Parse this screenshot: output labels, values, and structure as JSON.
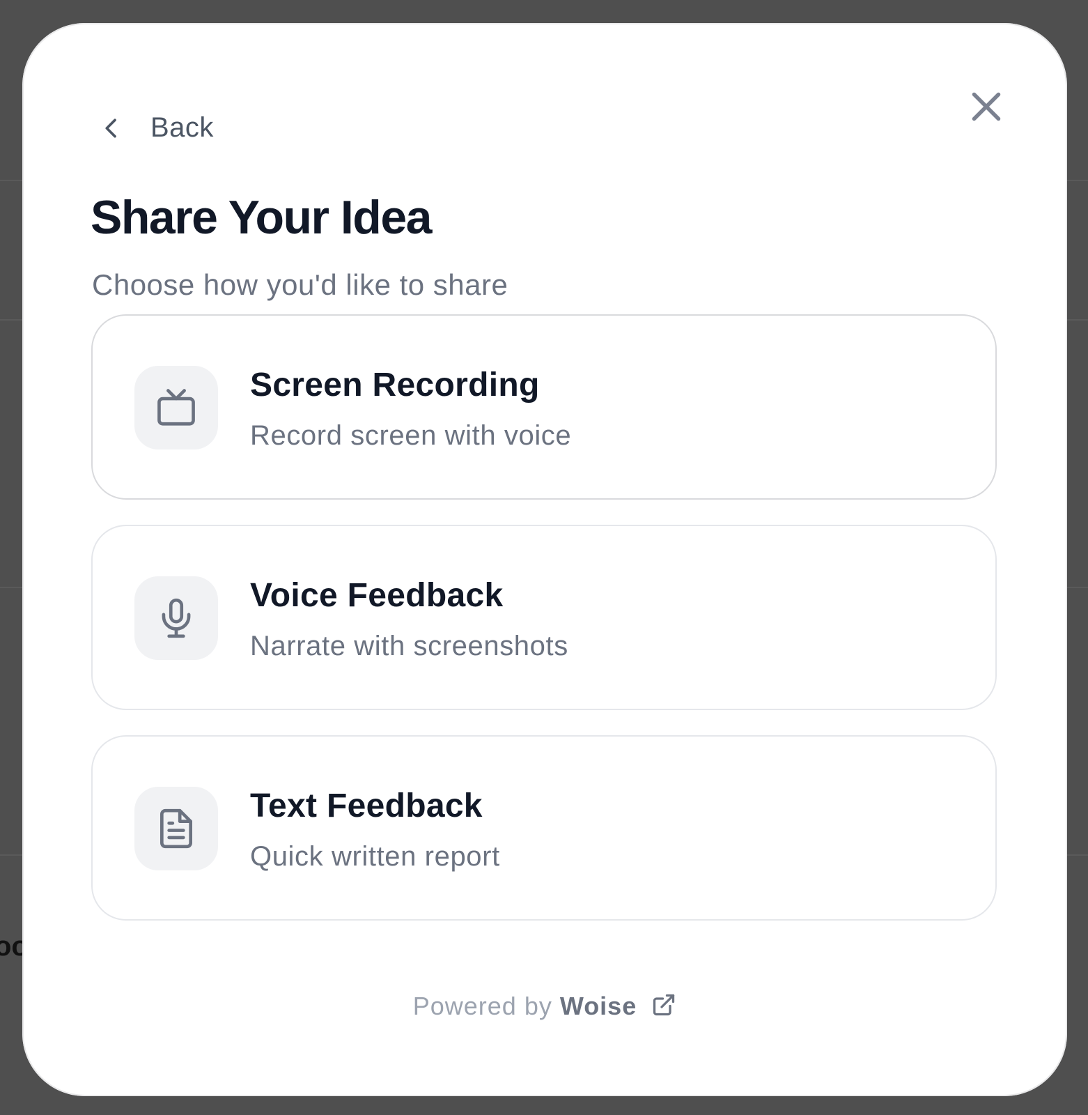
{
  "background": {
    "partial_text": "oo"
  },
  "modal": {
    "back_label": "Back",
    "title": "Share Your Idea",
    "subtitle": "Choose how you'd like to share",
    "options": [
      {
        "icon": "tv-icon",
        "title": "Screen Recording",
        "description": "Record screen with voice"
      },
      {
        "icon": "microphone-icon",
        "title": "Voice Feedback",
        "description": "Narrate with screenshots"
      },
      {
        "icon": "document-icon",
        "title": "Text Feedback",
        "description": "Quick written report"
      }
    ],
    "footer": {
      "prefix": "Powered by",
      "brand": "Woise",
      "icon": "external-link-icon"
    }
  },
  "colors": {
    "overlay": "#4f4f4f",
    "title": "#111827",
    "muted": "#6b7280",
    "border": "#e5e7eb",
    "icon_bg": "#f1f2f4"
  }
}
